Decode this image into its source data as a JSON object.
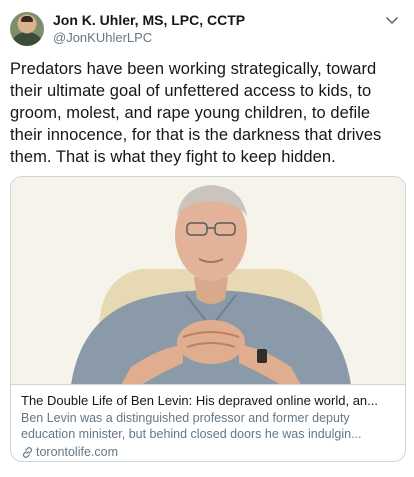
{
  "tweet": {
    "author": {
      "display_name": "Jon K. Uhler, MS, LPC, CCTP",
      "handle": "@JonKUhlerLPC",
      "avatar_icon": "avatar-photo"
    },
    "menu_icon": "chevron-down-icon",
    "text": "Predators have been working strategically, toward their ultimate goal of unfettered access to kids, to groom, molest, and rape young children, to defile their innocence, for that is the darkness that drives them. That is what they fight to keep hidden.",
    "card": {
      "title": "The Double Life of Ben Levin: His depraved online world, an...",
      "description": "Ben Levin was a distinguished professor and former deputy education minister, but behind closed doors he was indulgin...",
      "domain": "torontolife.com",
      "domain_icon": "link-icon"
    }
  },
  "colors": {
    "text_primary": "#14171a",
    "text_secondary": "#657786",
    "border": "#ccd6dd"
  }
}
